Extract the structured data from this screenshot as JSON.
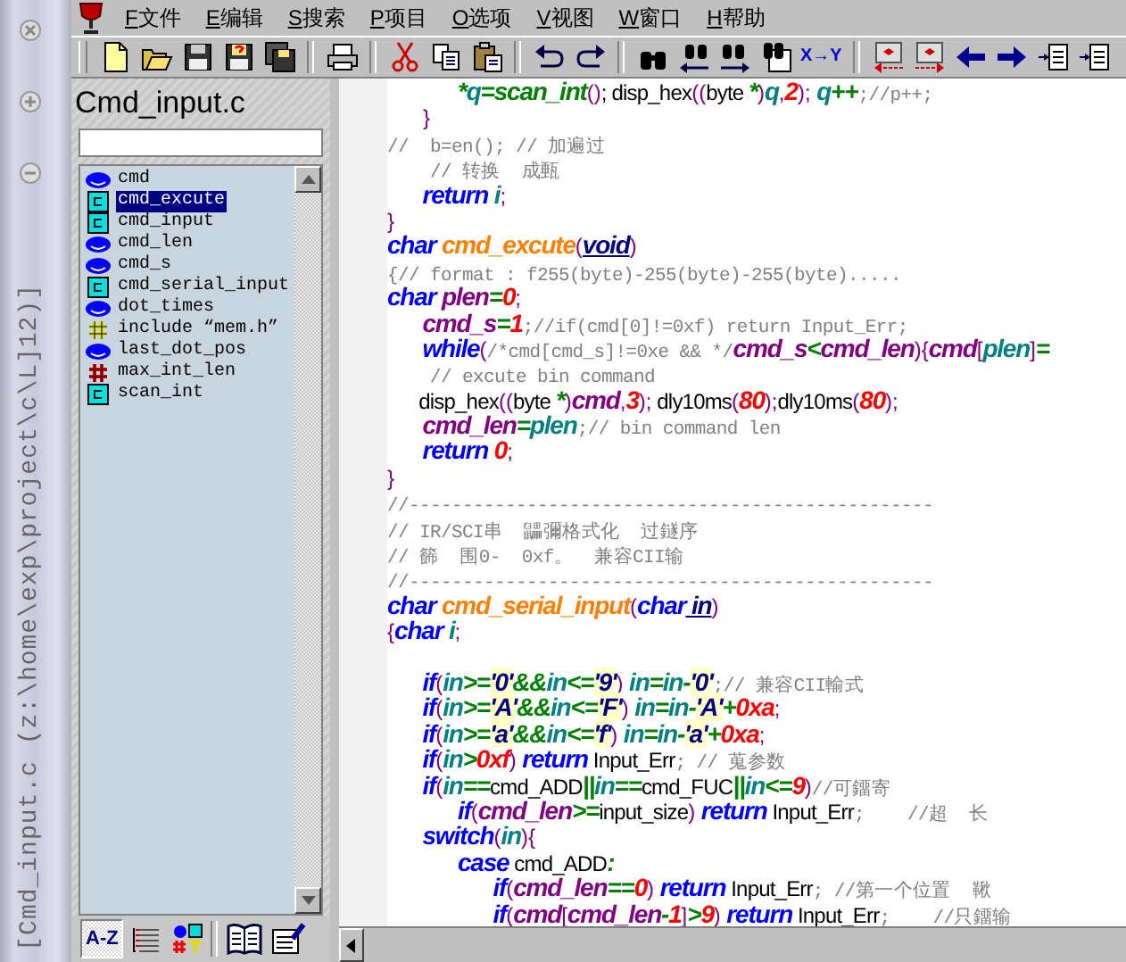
{
  "window": {
    "title": "[Cmd_input.c  (z:\\home\\exp\\project\\c\\L]12)]"
  },
  "menu": {
    "items": [
      {
        "key": "F",
        "label": "文件"
      },
      {
        "key": "E",
        "label": "编辑"
      },
      {
        "key": "S",
        "label": "搜索"
      },
      {
        "key": "P",
        "label": "项目"
      },
      {
        "key": "O",
        "label": "选项"
      },
      {
        "key": "V",
        "label": "视图"
      },
      {
        "key": "W",
        "label": "窗口"
      },
      {
        "key": "H",
        "label": "帮助"
      }
    ]
  },
  "toolbar": {
    "items": [
      {
        "kind": "new"
      },
      {
        "kind": "open"
      },
      {
        "kind": "save"
      },
      {
        "kind": "save-as"
      },
      {
        "kind": "save-all"
      },
      {
        "kind": "separator"
      },
      {
        "kind": "print"
      },
      {
        "kind": "separator"
      },
      {
        "kind": "cut"
      },
      {
        "kind": "copy"
      },
      {
        "kind": "paste"
      },
      {
        "kind": "separator"
      },
      {
        "kind": "undo"
      },
      {
        "kind": "redo"
      },
      {
        "kind": "separator"
      },
      {
        "kind": "find"
      },
      {
        "kind": "find-prev"
      },
      {
        "kind": "find-next"
      },
      {
        "kind": "find-files"
      },
      {
        "kind": "replace",
        "label": "X→Y"
      },
      {
        "kind": "separator"
      },
      {
        "kind": "mark-prev"
      },
      {
        "kind": "mark-next"
      },
      {
        "kind": "back"
      },
      {
        "kind": "forward"
      },
      {
        "kind": "indent"
      },
      {
        "kind": "indent"
      }
    ]
  },
  "symbol_panel": {
    "title": "Cmd_input.c",
    "items": [
      {
        "kind": "variable",
        "label": "cmd",
        "selected": false
      },
      {
        "kind": "function",
        "label": "cmd_excute",
        "selected": true
      },
      {
        "kind": "function",
        "label": "cmd_input",
        "selected": false
      },
      {
        "kind": "variable",
        "label": "cmd_len",
        "selected": false
      },
      {
        "kind": "variable",
        "label": "cmd_s",
        "selected": false
      },
      {
        "kind": "function",
        "label": "cmd_serial_input",
        "selected": false
      },
      {
        "kind": "variable",
        "label": "dot_times",
        "selected": false
      },
      {
        "kind": "include",
        "label": "include “mem.h”",
        "selected": false
      },
      {
        "kind": "variable",
        "label": "last_dot_pos",
        "selected": false
      },
      {
        "kind": "define",
        "label": "max_int_len",
        "selected": false
      },
      {
        "kind": "function",
        "label": "scan_int",
        "selected": false
      }
    ],
    "tools": [
      {
        "kind": "sort",
        "label": "A-Z",
        "selected": true
      },
      {
        "kind": "list",
        "selected": false
      },
      {
        "kind": "types",
        "selected": false
      },
      {
        "kind": "separator"
      },
      {
        "kind": "book"
      },
      {
        "kind": "properties"
      }
    ]
  },
  "editor": {
    "lines": [
      {
        "tokens": [
          {
            "kind": "op",
            "text": "            *"
          },
          {
            "kind": "par",
            "text": "q"
          },
          {
            "kind": "op",
            "text": "=scan_int"
          },
          {
            "kind": "pun",
            "text": "()"
          },
          {
            "kind": "txt",
            "text": "; disp_hex"
          },
          {
            "kind": "pun",
            "text": "(("
          },
          {
            "kind": "txt",
            "text": "byte "
          },
          {
            "kind": "op",
            "text": "*"
          },
          {
            "kind": "pun",
            "text": ")"
          },
          {
            "kind": "par",
            "text": "q"
          },
          {
            "kind": "pun",
            "text": ","
          },
          {
            "kind": "num",
            "text": "2"
          },
          {
            "kind": "pun",
            "text": ");"
          },
          {
            "kind": "par",
            "text": " q"
          },
          {
            "kind": "op",
            "text": "++"
          },
          {
            "kind": "cmt",
            "text": ";//p++;"
          }
        ]
      },
      {
        "tokens": [
          {
            "kind": "pun",
            "text": "      }"
          }
        ]
      },
      {
        "tokens": [
          {
            "kind": "cmt",
            "text": "//  b=en(); // 加遍过"
          }
        ]
      },
      {
        "tokens": [
          {
            "kind": "cmt",
            "text": "    // 转换  成甀"
          }
        ]
      },
      {
        "tokens": [
          {
            "kind": "kw",
            "text": "      return"
          },
          {
            "kind": "par",
            "text": " i"
          },
          {
            "kind": "pun",
            "text": ";"
          }
        ]
      },
      {
        "tokens": [
          {
            "kind": "pun",
            "text": "}"
          }
        ]
      },
      {
        "tokens": [
          {
            "kind": "kw",
            "text": "char"
          },
          {
            "kind": "fn",
            "text": " cmd_excute"
          },
          {
            "kind": "pun",
            "text": "("
          },
          {
            "kind": "arg",
            "text": "void"
          },
          {
            "kind": "pun",
            "text": ")"
          }
        ]
      },
      {
        "tokens": [
          {
            "kind": "cmt",
            "text": "{// format : f255(byte)-255(byte)-255(byte)....."
          }
        ]
      },
      {
        "tokens": [
          {
            "kind": "kw",
            "text": "char"
          },
          {
            "kind": "var",
            "text": " plen"
          },
          {
            "kind": "op",
            "text": "="
          },
          {
            "kind": "num",
            "text": "0"
          },
          {
            "kind": "pun",
            "text": ";"
          }
        ]
      },
      {
        "tokens": [
          {
            "kind": "var",
            "text": "      cmd_s"
          },
          {
            "kind": "op",
            "text": "="
          },
          {
            "kind": "num",
            "text": "1"
          },
          {
            "kind": "cmt",
            "text": ";//if(cmd[0]!=0xf) return Input_Err;"
          }
        ]
      },
      {
        "tokens": [
          {
            "kind": "kw",
            "text": "      while"
          },
          {
            "kind": "pun",
            "text": "("
          },
          {
            "kind": "cmt",
            "text": "/*cmd[cmd_s]!=0xe && */"
          },
          {
            "kind": "var",
            "text": "cmd_s"
          },
          {
            "kind": "op",
            "text": "<"
          },
          {
            "kind": "var",
            "text": "cmd_len"
          },
          {
            "kind": "pun",
            "text": "){"
          },
          {
            "kind": "var",
            "text": "cmd"
          },
          {
            "kind": "pun",
            "text": "["
          },
          {
            "kind": "par",
            "text": "plen"
          },
          {
            "kind": "pun",
            "text": "]"
          },
          {
            "kind": "op",
            "text": "="
          }
        ]
      },
      {
        "tokens": [
          {
            "kind": "cmt",
            "text": "    // excute bin command"
          }
        ]
      },
      {
        "tokens": [
          {
            "kind": "txt",
            "text": "      disp_hex"
          },
          {
            "kind": "pun",
            "text": "(("
          },
          {
            "kind": "txt",
            "text": "byte "
          },
          {
            "kind": "op",
            "text": "*"
          },
          {
            "kind": "pun",
            "text": ")"
          },
          {
            "kind": "var",
            "text": "cmd"
          },
          {
            "kind": "pun",
            "text": ","
          },
          {
            "kind": "num",
            "text": "3"
          },
          {
            "kind": "pun",
            "text": ");"
          },
          {
            "kind": "txt",
            "text": " dly10ms"
          },
          {
            "kind": "pun",
            "text": "("
          },
          {
            "kind": "num",
            "text": "80"
          },
          {
            "kind": "pun",
            "text": ");"
          },
          {
            "kind": "txt",
            "text": "dly10ms"
          },
          {
            "kind": "pun",
            "text": "("
          },
          {
            "kind": "num",
            "text": "80"
          },
          {
            "kind": "pun",
            "text": ");"
          }
        ]
      },
      {
        "tokens": [
          {
            "kind": "var",
            "text": "      cmd_len"
          },
          {
            "kind": "op",
            "text": "="
          },
          {
            "kind": "par",
            "text": "plen"
          },
          {
            "kind": "cmt",
            "text": ";// bin command len"
          }
        ]
      },
      {
        "tokens": [
          {
            "kind": "kw",
            "text": "      return"
          },
          {
            "kind": "num",
            "text": " 0"
          },
          {
            "kind": "pun",
            "text": ";"
          }
        ]
      },
      {
        "tokens": [
          {
            "kind": "pun",
            "text": "}"
          }
        ]
      },
      {
        "tokens": [
          {
            "kind": "cmt",
            "text": "//-------------------------------------------------"
          }
        ]
      },
      {
        "tokens": [
          {
            "kind": "cmt",
            "text": "// IR/SCI串  鼺彌格式化  过鐩序"
          }
        ]
      },
      {
        "tokens": [
          {
            "kind": "cmt",
            "text": "// 籂  围0-  0xf。  兼容CII输"
          }
        ]
      },
      {
        "tokens": [
          {
            "kind": "cmt",
            "text": "//-------------------------------------------------"
          }
        ]
      },
      {
        "tokens": [
          {
            "kind": "kw",
            "text": "char"
          },
          {
            "kind": "fn",
            "text": " cmd_serial_input"
          },
          {
            "kind": "pun",
            "text": "("
          },
          {
            "kind": "kw",
            "text": "char"
          },
          {
            "kind": "arg",
            "text": " in"
          },
          {
            "kind": "pun",
            "text": ")"
          }
        ]
      },
      {
        "tokens": [
          {
            "kind": "pun",
            "text": "{"
          },
          {
            "kind": "kw",
            "text": "char"
          },
          {
            "kind": "par",
            "text": " i"
          },
          {
            "kind": "pun",
            "text": ";"
          }
        ]
      },
      {
        "gap_before": true,
        "tokens": [
          {
            "kind": "kw",
            "text": "      if"
          },
          {
            "kind": "pun",
            "text": "("
          },
          {
            "kind": "par",
            "text": "in"
          },
          {
            "kind": "op",
            "text": ">="
          },
          {
            "kind": "chr",
            "text": "'0'"
          },
          {
            "kind": "op",
            "text": "&&"
          },
          {
            "kind": "par",
            "text": "in"
          },
          {
            "kind": "op",
            "text": "<="
          },
          {
            "kind": "chr",
            "text": "'9'"
          },
          {
            "kind": "pun",
            "text": ")"
          },
          {
            "kind": "par",
            "text": " in"
          },
          {
            "kind": "op",
            "text": "="
          },
          {
            "kind": "par",
            "text": "in"
          },
          {
            "kind": "op",
            "text": "-"
          },
          {
            "kind": "chr",
            "text": "'0'"
          },
          {
            "kind": "cmt",
            "text": ";// 兼容CII輸式"
          }
        ]
      },
      {
        "tokens": [
          {
            "kind": "kw",
            "text": "      if"
          },
          {
            "kind": "pun",
            "text": "("
          },
          {
            "kind": "par",
            "text": "in"
          },
          {
            "kind": "op",
            "text": ">="
          },
          {
            "kind": "chr",
            "text": "'A'"
          },
          {
            "kind": "op",
            "text": "&&"
          },
          {
            "kind": "par",
            "text": "in"
          },
          {
            "kind": "op",
            "text": "<="
          },
          {
            "kind": "chr",
            "text": "'F'"
          },
          {
            "kind": "pun",
            "text": ")"
          },
          {
            "kind": "par",
            "text": " in"
          },
          {
            "kind": "op",
            "text": "="
          },
          {
            "kind": "par",
            "text": "in"
          },
          {
            "kind": "op",
            "text": "-"
          },
          {
            "kind": "chr",
            "text": "'A'"
          },
          {
            "kind": "op",
            "text": "+"
          },
          {
            "kind": "num",
            "text": "0xa"
          },
          {
            "kind": "pun",
            "text": ";"
          }
        ]
      },
      {
        "tokens": [
          {
            "kind": "kw",
            "text": "      if"
          },
          {
            "kind": "pun",
            "text": "("
          },
          {
            "kind": "par",
            "text": "in"
          },
          {
            "kind": "op",
            "text": ">="
          },
          {
            "kind": "chr",
            "text": "'a'"
          },
          {
            "kind": "op",
            "text": "&&"
          },
          {
            "kind": "par",
            "text": "in"
          },
          {
            "kind": "op",
            "text": "<="
          },
          {
            "kind": "chr",
            "text": "'f'"
          },
          {
            "kind": "pun",
            "text": ")"
          },
          {
            "kind": "par",
            "text": " in"
          },
          {
            "kind": "op",
            "text": "="
          },
          {
            "kind": "par",
            "text": "in"
          },
          {
            "kind": "op",
            "text": "-"
          },
          {
            "kind": "chr",
            "text": "'a'"
          },
          {
            "kind": "op",
            "text": "+"
          },
          {
            "kind": "num",
            "text": "0xa"
          },
          {
            "kind": "pun",
            "text": ";"
          }
        ]
      },
      {
        "tokens": [
          {
            "kind": "kw",
            "text": "      if"
          },
          {
            "kind": "pun",
            "text": "("
          },
          {
            "kind": "par",
            "text": "in"
          },
          {
            "kind": "op",
            "text": ">"
          },
          {
            "kind": "num",
            "text": "0xf"
          },
          {
            "kind": "pun",
            "text": ")"
          },
          {
            "kind": "kw",
            "text": " return"
          },
          {
            "kind": "txt",
            "text": " Input_Err"
          },
          {
            "kind": "cmt",
            "text": "; // 蒐参数"
          }
        ]
      },
      {
        "tokens": [
          {
            "kind": "kw",
            "text": "      if"
          },
          {
            "kind": "pun",
            "text": "("
          },
          {
            "kind": "par",
            "text": "in"
          },
          {
            "kind": "op",
            "text": "=="
          },
          {
            "kind": "txt",
            "text": "cmd_ADD"
          },
          {
            "kind": "op",
            "text": "||"
          },
          {
            "kind": "par",
            "text": "in"
          },
          {
            "kind": "op",
            "text": "=="
          },
          {
            "kind": "txt",
            "text": "cmd_FUC"
          },
          {
            "kind": "op",
            "text": "||"
          },
          {
            "kind": "par",
            "text": "in"
          },
          {
            "kind": "op",
            "text": "<="
          },
          {
            "kind": "num",
            "text": "9"
          },
          {
            "kind": "pun",
            "text": ")"
          },
          {
            "kind": "cmt",
            "text": "//可鐂寄"
          }
        ]
      },
      {
        "tokens": [
          {
            "kind": "kw",
            "text": "            if"
          },
          {
            "kind": "pun",
            "text": "("
          },
          {
            "kind": "var",
            "text": "cmd_len"
          },
          {
            "kind": "op",
            "text": ">="
          },
          {
            "kind": "txt",
            "text": "input_size"
          },
          {
            "kind": "pun",
            "text": ")"
          },
          {
            "kind": "kw",
            "text": " return"
          },
          {
            "kind": "txt",
            "text": " Input_Err"
          },
          {
            "kind": "cmt",
            "text": ";    //超  长"
          }
        ]
      },
      {
        "tokens": [
          {
            "kind": "kw",
            "text": "      switch"
          },
          {
            "kind": "pun",
            "text": "("
          },
          {
            "kind": "par",
            "text": "in"
          },
          {
            "kind": "pun",
            "text": "){"
          }
        ]
      },
      {
        "tokens": [
          {
            "kind": "kw",
            "text": "            case"
          },
          {
            "kind": "txt",
            "text": " cmd_ADD"
          },
          {
            "kind": "op",
            "text": ":"
          }
        ]
      },
      {
        "tokens": [
          {
            "kind": "kw",
            "text": "                  if"
          },
          {
            "kind": "pun",
            "text": "("
          },
          {
            "kind": "var",
            "text": "cmd_len"
          },
          {
            "kind": "op",
            "text": "=="
          },
          {
            "kind": "num",
            "text": "0"
          },
          {
            "kind": "pun",
            "text": ")"
          },
          {
            "kind": "kw",
            "text": " return"
          },
          {
            "kind": "txt",
            "text": " Input_Err"
          },
          {
            "kind": "cmt",
            "text": "; //第一个位置  鞦"
          }
        ]
      },
      {
        "tokens": [
          {
            "kind": "kw",
            "text": "                  if"
          },
          {
            "kind": "pun",
            "text": "("
          },
          {
            "kind": "var",
            "text": "cmd"
          },
          {
            "kind": "pun",
            "text": "["
          },
          {
            "kind": "var",
            "text": "cmd_len"
          },
          {
            "kind": "op",
            "text": "-"
          },
          {
            "kind": "num",
            "text": "1"
          },
          {
            "kind": "pun",
            "text": "]"
          },
          {
            "kind": "op",
            "text": ">"
          },
          {
            "kind": "num",
            "text": "9"
          },
          {
            "kind": "pun",
            "text": ")"
          },
          {
            "kind": "kw",
            "text": " return"
          },
          {
            "kind": "txt",
            "text": " Input_Err"
          },
          {
            "kind": "cmt",
            "text": ";    //只鐂输"
          }
        ]
      }
    ]
  }
}
